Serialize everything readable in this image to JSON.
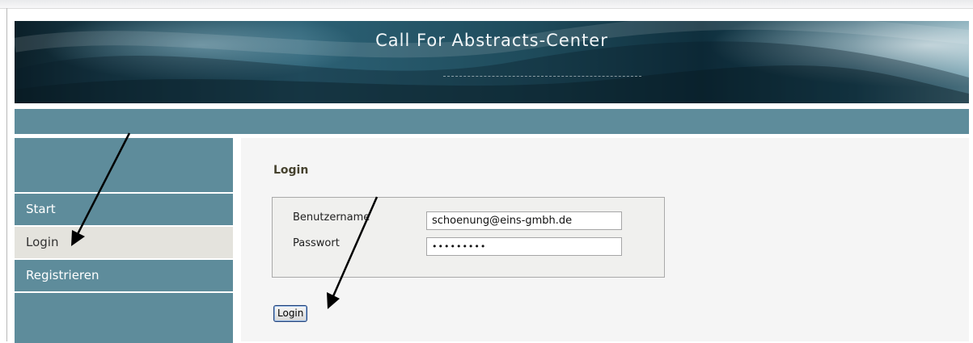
{
  "header": {
    "title": "Call For Abstracts-Center"
  },
  "sidebar": {
    "items": [
      {
        "label": "Start",
        "active": false
      },
      {
        "label": "Login",
        "active": true
      },
      {
        "label": "Registrieren",
        "active": false
      }
    ]
  },
  "main": {
    "heading": "Login",
    "form": {
      "username_label": "Benutzername",
      "username_value": "schoenung@eins-gmbh.de",
      "password_label": "Passwort",
      "password_value": "•••••••••",
      "submit_label": "Login"
    }
  },
  "colors": {
    "nav_bar": "#5e8c9b",
    "sidebar_item": "#5e8c9b",
    "sidebar_active": "#e4e3dd",
    "main_background": "#f5f5f5",
    "heading_text": "#46422e",
    "annotation_arrow": "#000000"
  }
}
